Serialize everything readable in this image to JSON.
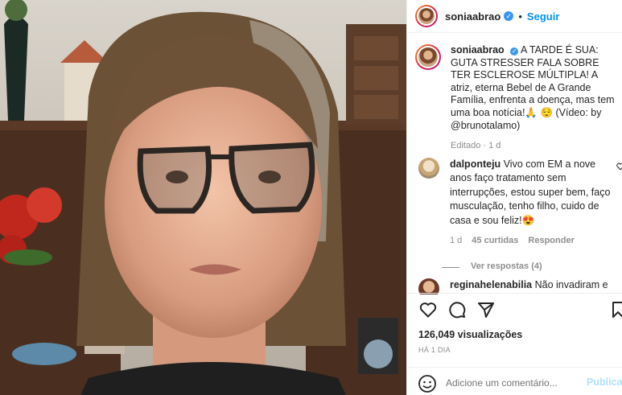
{
  "post": {
    "username": "soniaabrao",
    "follow_label": "Seguir",
    "separator": "•",
    "caption_text": "A TARDE É SUA: GUTA STRESSER FALA SOBRE TER ESCLEROSE MÚLTIPLA! A atriz, eterna Bebel de A Grande Família, enfrenta a doença, mas tem uma boa notícia!🙏 😌 (Vídeo: by @brunotalamo)",
    "edited_label": "Editado · 1 d"
  },
  "comments": [
    {
      "username": "dalponteju",
      "text": "Vivo com EM a nove anos faço tratamento sem interrupções, estou super bem, faço musculação, tenho filho, cuido de casa e sou feliz!😍",
      "time": "1 d",
      "likes": "45 curtidas",
      "reply": "Responder",
      "view_replies": "Ver respostas (4)"
    },
    {
      "username": "reginahelenabilia",
      "text": "Não invadiram e"
    }
  ],
  "stats": {
    "views": "126,049 visualizações",
    "posted": "HÁ 1 DIA"
  },
  "comment_box": {
    "placeholder": "Adicione um comentário...",
    "publish": "Publicar"
  },
  "colors": {
    "accent": "#0095f6",
    "verified": "#3897f0",
    "muted": "#8e8e8e",
    "text": "#262626"
  },
  "icons": [
    "verified-badge-icon",
    "heart-icon",
    "comment-icon",
    "share-icon",
    "bookmark-icon",
    "emoji-icon"
  ]
}
